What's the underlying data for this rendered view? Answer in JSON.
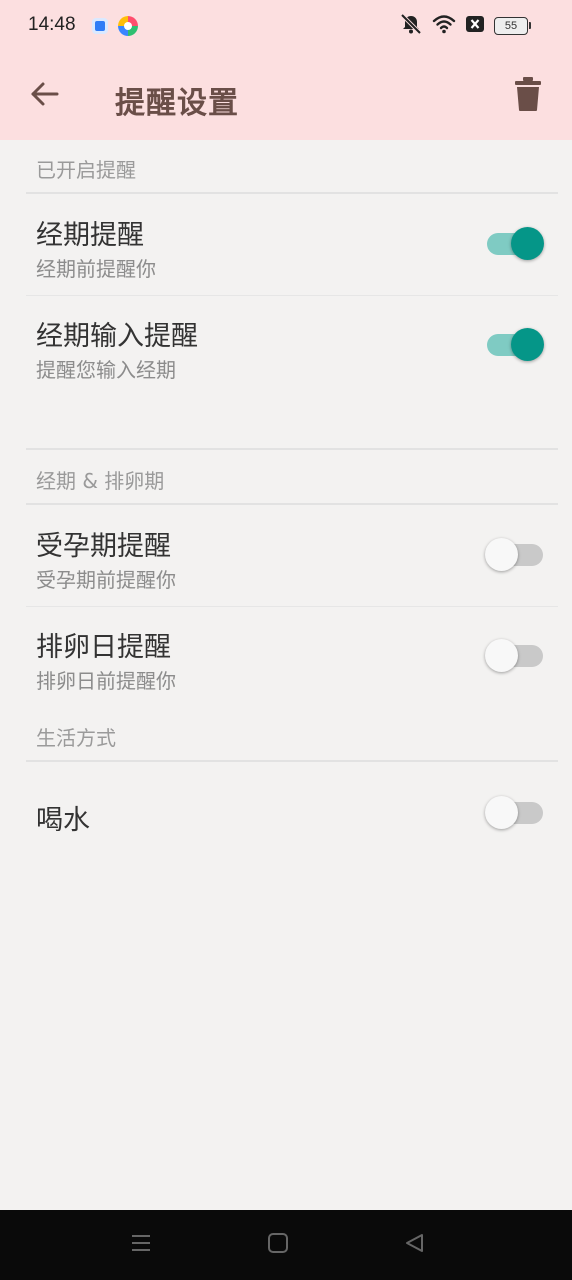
{
  "status_bar": {
    "time": "14:48",
    "battery": "55",
    "icons": [
      "app-icon-blue",
      "app-icon-colorful",
      "mute-bell-icon",
      "wifi-icon",
      "close-box-icon",
      "battery-icon"
    ]
  },
  "app_bar": {
    "title": "提醒设置",
    "back_icon": "back-arrow-icon",
    "delete_icon": "trash-icon"
  },
  "sections": {
    "enabled": {
      "header": "已开启提醒",
      "items": [
        {
          "title": "经期提醒",
          "subtitle": "经期前提醒你",
          "enabled": true
        },
        {
          "title": "经期输入提醒",
          "subtitle": "提醒您输入经期",
          "enabled": true
        }
      ]
    },
    "period_ovulation": {
      "header": "经期 & 排卵期",
      "items": [
        {
          "title": "受孕期提醒",
          "subtitle": "受孕期前提醒你",
          "enabled": false
        },
        {
          "title": "排卵日提醒",
          "subtitle": "排卵日前提醒你",
          "enabled": false
        }
      ]
    },
    "lifestyle": {
      "header": "生活方式",
      "items": [
        {
          "title": "喝水",
          "enabled": false
        }
      ]
    }
  },
  "colors": {
    "app_bar_bg": "#fcdfe0",
    "title_color": "#6a4e48",
    "switch_on_thumb": "#059688",
    "switch_on_track": "#7fcbc3",
    "background": "#f3f2f1"
  },
  "nav_bar": {
    "icons": [
      "menu-icon",
      "home-square-icon",
      "back-triangle-icon"
    ]
  }
}
